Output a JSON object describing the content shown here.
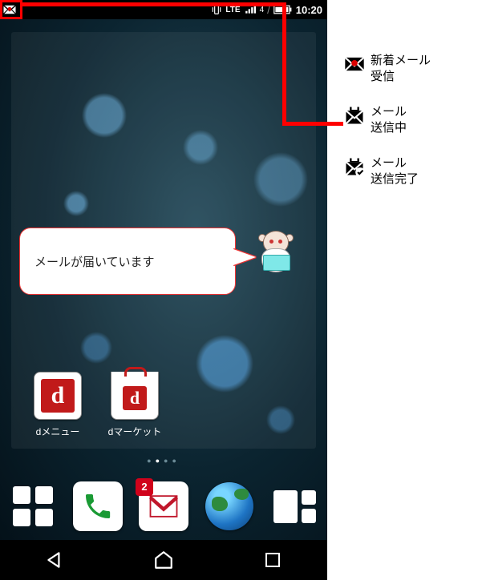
{
  "status_bar": {
    "time": "10:20",
    "network_label": "LTE",
    "signal_label": "4"
  },
  "bubble_text": "メールが届いています",
  "apps": {
    "dmenu": "dメニュー",
    "dmarket": "dマーケット"
  },
  "dock": {
    "mail_badge": "2"
  },
  "legend": {
    "new_mail_l1": "新着メール",
    "new_mail_l2": "受信",
    "sending_l1": "メール",
    "sending_l2": "送信中",
    "sent_l1": "メール",
    "sent_l2": "送信完了"
  }
}
